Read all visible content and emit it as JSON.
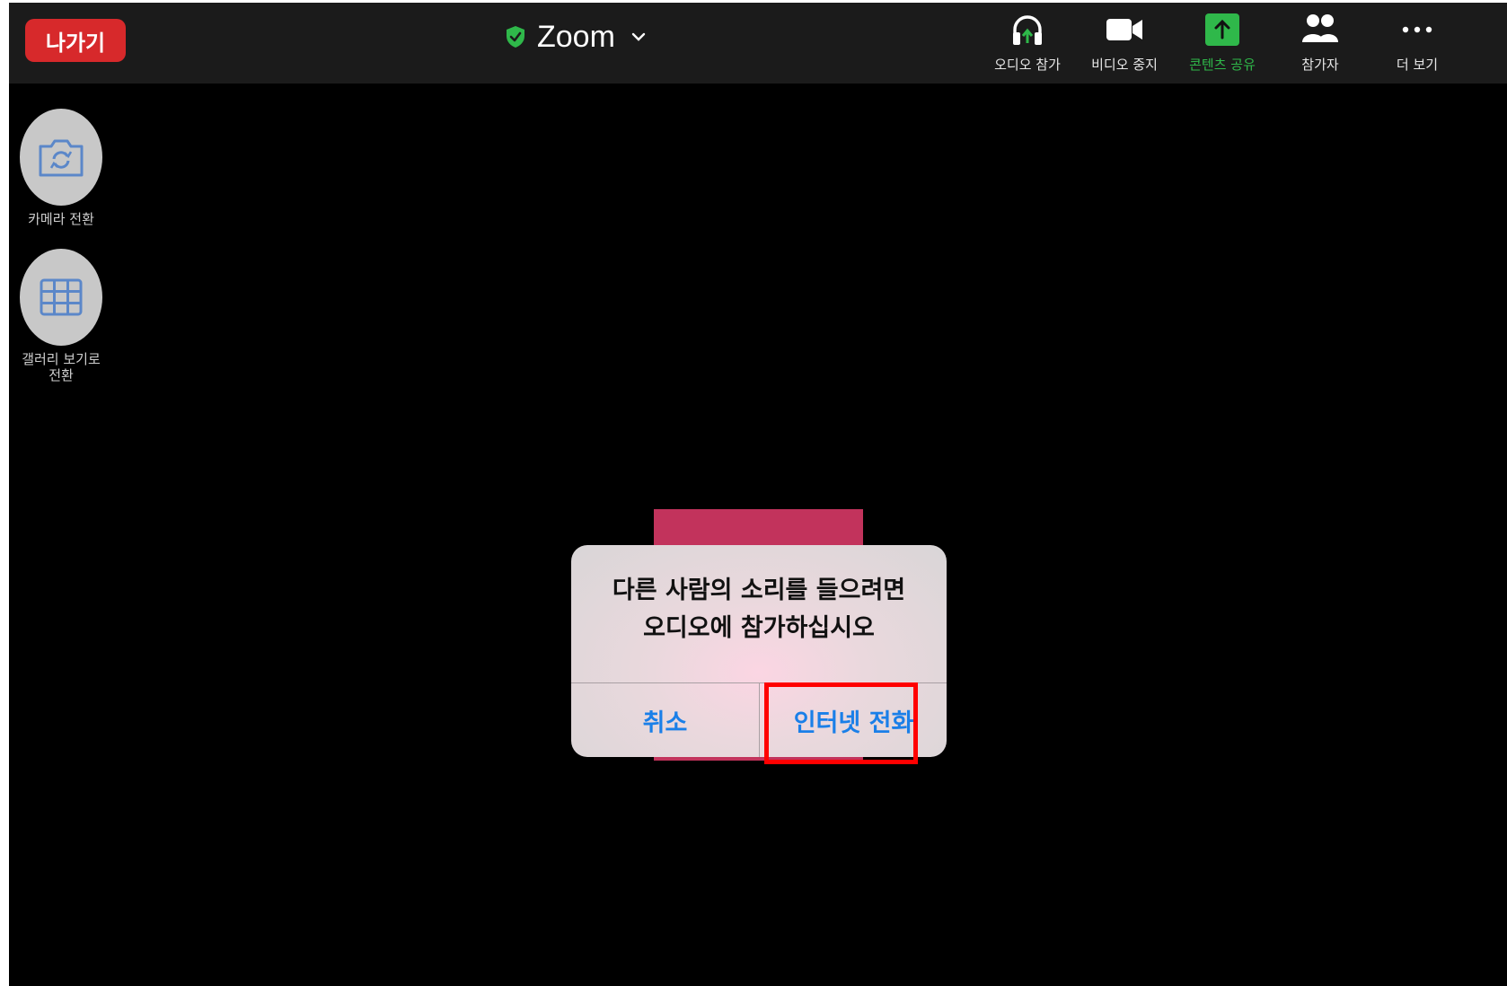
{
  "header": {
    "leave_label": "나가기",
    "title": "Zoom"
  },
  "toolbar": [
    {
      "label": "오디오 참가",
      "icon": "headphones-icon"
    },
    {
      "label": "비디오 중지",
      "icon": "video-camera-icon"
    },
    {
      "label": "콘텐츠 공유",
      "icon": "share-screen-icon"
    },
    {
      "label": "참가자",
      "icon": "participants-icon"
    },
    {
      "label": "더 보기",
      "icon": "more-icon"
    }
  ],
  "sidebar": {
    "camera_switch_label": "카메라 전환",
    "gallery_label": "갤러리 보기로 전환"
  },
  "dialog": {
    "line1": "다른 사람의 소리를 들으려면",
    "line2": "오디오에 참가하십시오",
    "cancel_label": "취소",
    "call_label": "인터넷 전화"
  },
  "colors": {
    "leave": "#d7292b",
    "share": "#2fb84a",
    "dialog_button": "#1a7fe8",
    "highlight": "#ff0000"
  }
}
